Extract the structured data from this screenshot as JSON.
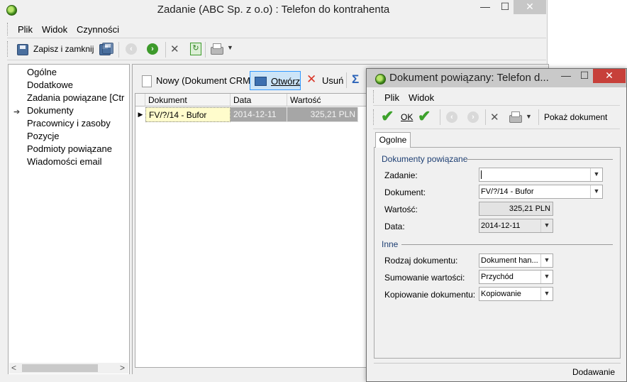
{
  "main_window": {
    "title": "Zadanie (ABC Sp. z o.o) : Telefon do kontrahenta",
    "controls": {
      "minimize": "—",
      "maximize": "☐",
      "close": "✕"
    }
  },
  "menu": {
    "file": "Plik",
    "view": "Widok",
    "actions": "Czynności"
  },
  "toolbar": {
    "save_close": "Zapisz i zamknij"
  },
  "nav": {
    "items": [
      "Ogólne",
      "Dodatkowe",
      "Zadania powiązane [Ctr",
      "Dokumenty",
      "Pracownicy i zasoby",
      "Pozycje",
      "Podmioty powiązane",
      "Wiadomości email"
    ],
    "selected_index": 3,
    "scroll_left": "<",
    "scroll_right": ">"
  },
  "documents_toolbar": {
    "new": "Nowy (Dokument CRM)",
    "open": "Otwórz",
    "delete": "Usuń"
  },
  "grid": {
    "columns": [
      "Dokument",
      "Data",
      "Wartość"
    ],
    "rows": [
      {
        "document": "FV/?/14 - Bufor",
        "date": "2014-12-11",
        "value": "325,21 PLN"
      }
    ]
  },
  "dialog": {
    "title": "Dokument powiązany: Telefon d...",
    "controls": {
      "minimize": "—",
      "maximize": "☐",
      "close": "✕"
    },
    "menu": {
      "file": "Plik",
      "view": "Widok"
    },
    "toolbar": {
      "ok": "OK",
      "show_document": "Pokaż dokument"
    },
    "tab": "Ogolne",
    "section_related": "Dokumenty powiązane",
    "section_other": "Inne",
    "fields": {
      "task_label": "Zadanie:",
      "task_value": "",
      "document_label": "Dokument:",
      "document_value": "FV/?/14 - Bufor",
      "value_label": "Wartość:",
      "value_value": "325,21 PLN",
      "date_label": "Data:",
      "date_value": "2014-12-11",
      "doc_type_label": "Rodzaj dokumentu:",
      "doc_type_value": "Dokument han...",
      "sum_label": "Sumowanie wartości:",
      "sum_value": "Przychód",
      "copy_label": "Kopiowanie dokumentu:",
      "copy_value": "Kopiowanie"
    },
    "status": "Dodawanie"
  },
  "colors": {
    "window_bg": "#f0f0f0",
    "selection_bg": "#cce4f7",
    "selection_border": "#3399ff",
    "row_highlight": "#fffccc",
    "dialog_close": "#c7403a",
    "group_title": "#1e3f73"
  }
}
